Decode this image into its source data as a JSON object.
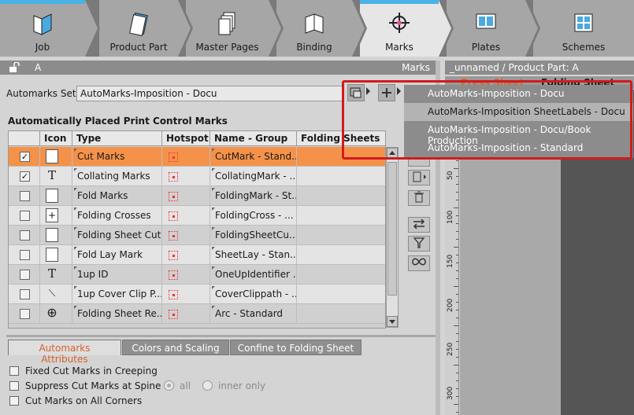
{
  "workflow": {
    "steps": [
      {
        "label": "Job",
        "icon": "book-icon"
      },
      {
        "label": "Product Part",
        "icon": "document-icon"
      },
      {
        "label": "Master Pages",
        "icon": "pages-icon"
      },
      {
        "label": "Binding",
        "icon": "binding-icon"
      },
      {
        "label": "Marks",
        "icon": "crosshair-icon"
      },
      {
        "label": "Plates",
        "icon": "plates-icon"
      },
      {
        "label": "Schemes",
        "icon": "schemes-icon"
      }
    ],
    "active": "Marks"
  },
  "panel_header": {
    "left": "A",
    "right": "Marks"
  },
  "automarks": {
    "label": "Automarks Set:",
    "value": "AutoMarks-Imposition - Docu"
  },
  "section_title": "Automatically Placed Print Control Marks",
  "table": {
    "headers": [
      "Icon",
      "Type",
      "Hotspot",
      "Name - Group",
      "Folding Sheets"
    ],
    "rows": [
      {
        "checked": true,
        "icon": "square",
        "type": "Cut Marks",
        "name": "CutMark - Stand...",
        "folding": ""
      },
      {
        "checked": true,
        "icon": "T",
        "type": "Collating Marks",
        "name": "CollatingMark - ...",
        "folding": ""
      },
      {
        "checked": false,
        "icon": "fold",
        "type": "Fold Marks",
        "name": "FoldingMark - St...",
        "folding": ""
      },
      {
        "checked": false,
        "icon": "+",
        "type": "Folding Crosses",
        "name": "FoldingCross - ...",
        "folding": ""
      },
      {
        "checked": false,
        "icon": "cut",
        "type": "Folding Sheet Cut",
        "name": "FoldingSheetCu...",
        "folding": ""
      },
      {
        "checked": false,
        "icon": "lay",
        "type": "Fold Lay Mark",
        "name": "SheetLay - Stan...",
        "folding": ""
      },
      {
        "checked": false,
        "icon": "T",
        "type": "1up ID",
        "name": "OneUpIdentifier ...",
        "folding": ""
      },
      {
        "checked": false,
        "icon": "wand",
        "type": "1up Cover Clip P...",
        "name": "CoverClippath - ...",
        "folding": ""
      },
      {
        "checked": false,
        "icon": "target",
        "type": "Folding Sheet Re...",
        "name": "Arc - Standard",
        "folding": ""
      }
    ]
  },
  "tabs": [
    "Automarks Attributes",
    "Colors and Scaling",
    "Confine to Folding Sheet"
  ],
  "options": {
    "fixed_cut": "Fixed Cut Marks in Creeping",
    "suppress": "Suppress Cut Marks at Spine",
    "radio_all": "all",
    "radio_inner": "inner only",
    "cut_all_corners": "Cut Marks on All Corners"
  },
  "right_panel": {
    "header": "_unnamed / Product Part: A",
    "tab1": "Press Sheet",
    "tab2": "Folding Sheet",
    "ruler_labels": [
      "50",
      "100",
      "150",
      "200",
      "250",
      "300"
    ]
  },
  "dropdown": {
    "items": [
      "AutoMarks-Imposition - Docu",
      "AutoMarks-Imposition SheetLabels - Docu",
      "AutoMarks-Imposition - Docu/Book Production",
      "AutoMarks-Imposition - Standard"
    ],
    "hovered_index": 1
  },
  "colors": {
    "accent": "#f5924a",
    "active_tab": "#d7602a",
    "highlight": "#d01c1c",
    "workflow_active_line": "#4ab3e6"
  }
}
